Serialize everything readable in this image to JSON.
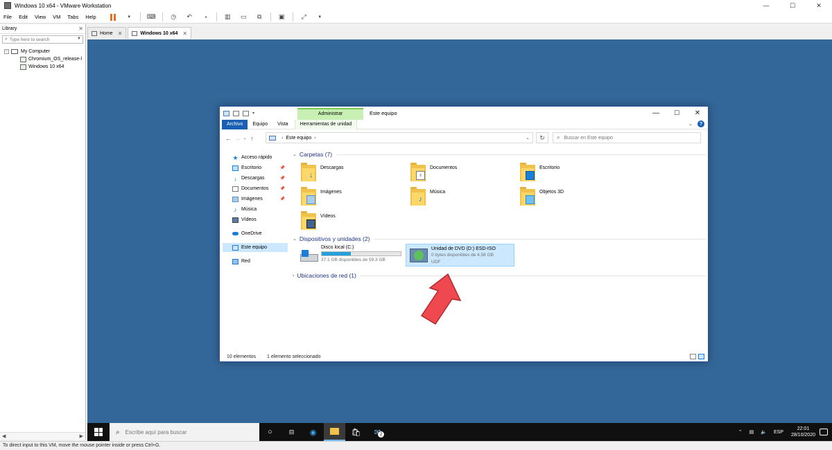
{
  "vmware": {
    "title": "Windows 10 x64 - VMware Workstation",
    "menu": [
      "File",
      "Edit",
      "View",
      "VM",
      "Tabs",
      "Help"
    ],
    "status_text": "To direct input to this VM, move the mouse pointer inside or press Ctrl+G.",
    "accent_color": "#e2731b"
  },
  "library": {
    "title": "Library",
    "search_placeholder": "Type here to search",
    "tree": {
      "root": "My Computer",
      "vms": [
        "Chromium_OS_release-l",
        "Windows 10 x64"
      ]
    }
  },
  "tabs": {
    "home": "Home",
    "vm": "Windows 10 x64"
  },
  "explorer": {
    "context_group": "Administrar",
    "window_title": "Este equipo",
    "ribbon_tabs": [
      "Archivo",
      "Equipo",
      "Vista",
      "Herramientas de unidad"
    ],
    "address_crumb": "Este equipo",
    "search_placeholder": "Buscar en Este equipo",
    "nav": {
      "quick_access": "Acceso rápido",
      "desktop": "Escritorio",
      "downloads": "Descargas",
      "documents": "Documentos",
      "images": "Imágenes",
      "music": "Música",
      "videos": "Vídeos",
      "onedrive": "OneDrive",
      "this_pc": "Este equipo",
      "network": "Red"
    },
    "groups": {
      "folders": "Carpetas (7)",
      "devices": "Dispositivos y unidades (2)",
      "network": "Ubicaciones de red (1)"
    },
    "folders": {
      "downloads": "Descargas",
      "documents": "Documentos",
      "desktop": "Escritorio",
      "images": "Imágenes",
      "music": "Música",
      "objects3d": "Objetos 3D",
      "videos": "Vídeos"
    },
    "drives": {
      "c": {
        "name": "Disco local (C:)",
        "free": "37.1 GB disponibles de 59.3 GB",
        "used_fraction": 0.37
      },
      "d": {
        "name": "Unidad de DVD (D:) ESD-ISO",
        "free": "0 bytes disponibles de 4.58 GB",
        "fs": "UDF"
      }
    },
    "status": {
      "count": "10 elementos",
      "selected": "1 elemento seleccionado"
    },
    "highlight_color": "#cce8ff"
  },
  "taskbar": {
    "search_placeholder": "Escribe aquí para buscar",
    "mail_badge": "2",
    "lang": "ESP",
    "time": "22:01",
    "date": "28/10/2020"
  },
  "annotation": {
    "arrow_color": "#f0484f"
  }
}
